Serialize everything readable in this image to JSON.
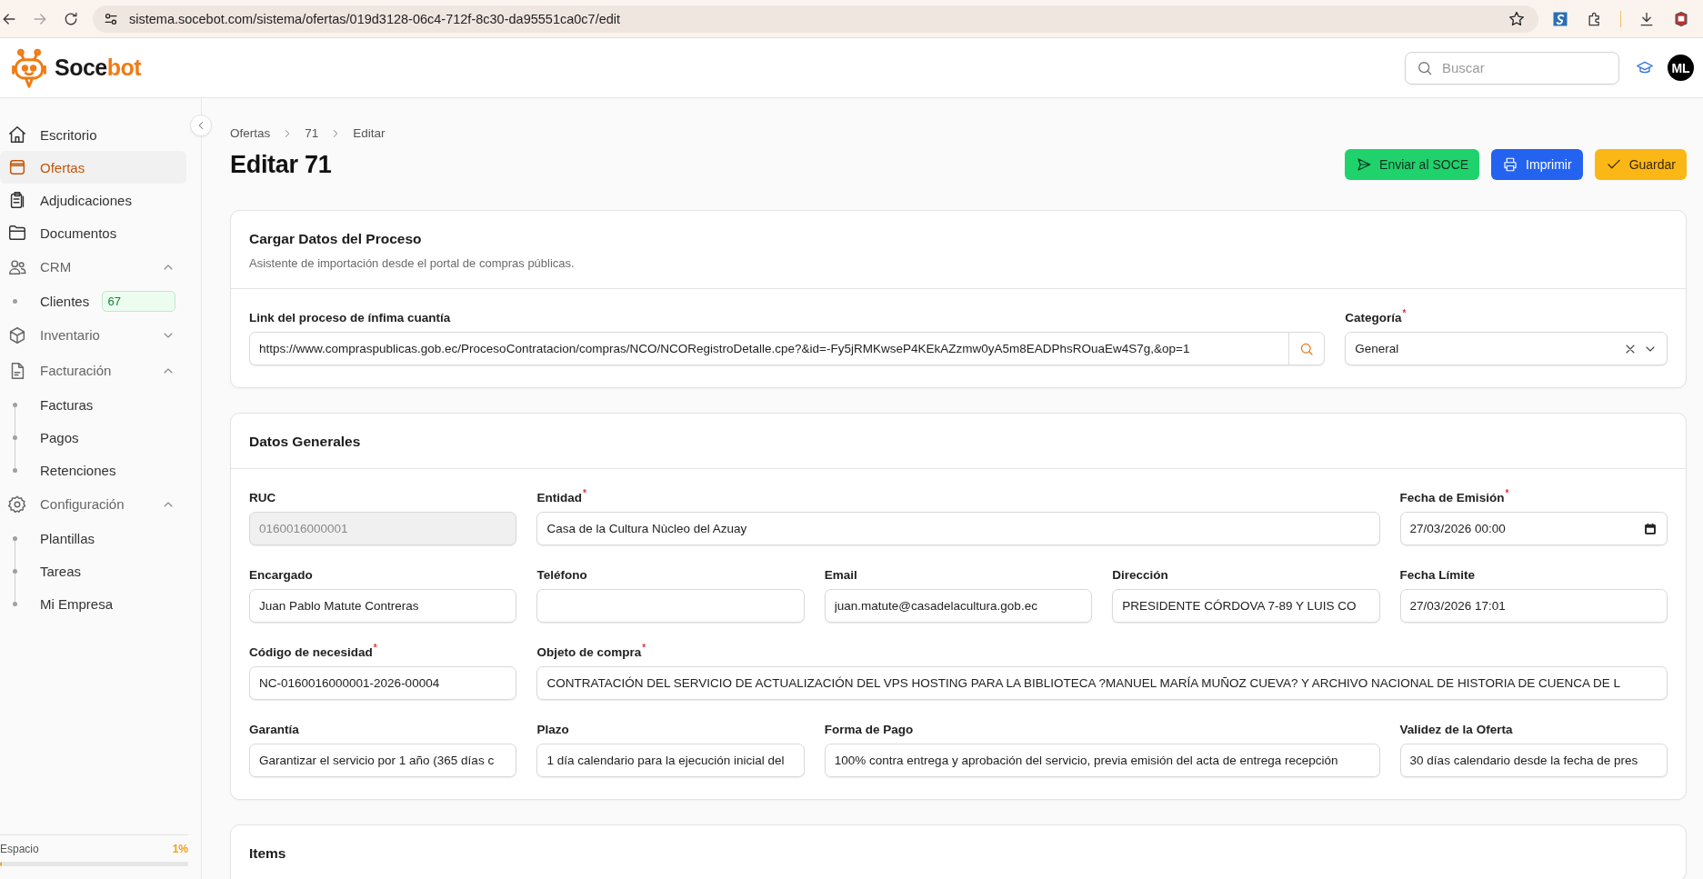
{
  "browser": {
    "url": "sistema.socebot.com/sistema/ofertas/019d3128-06c4-712f-8c30-da95551ca0c7/edit"
  },
  "header": {
    "logo": {
      "first": "Soce",
      "second": "bot"
    },
    "search": {
      "placeholder": "Buscar"
    },
    "avatar": "ML"
  },
  "sidebar": {
    "items": [
      {
        "label": "Escritorio",
        "selected": false
      },
      {
        "label": "Ofertas",
        "selected": true
      },
      {
        "label": "Adjudicaciones",
        "selected": false
      },
      {
        "label": "Documentos",
        "selected": false
      },
      {
        "label": "CRM",
        "selected": false,
        "expanded": true,
        "children": [
          {
            "label": "Clientes",
            "badge": "67",
            "selected": false
          }
        ]
      },
      {
        "label": "Inventario",
        "selected": false,
        "expanded": false
      },
      {
        "label": "Facturación",
        "selected": false,
        "expanded": true,
        "children": [
          {
            "label": "Facturas",
            "selected": false
          },
          {
            "label": "Pagos",
            "selected": false
          },
          {
            "label": "Retenciones",
            "selected": false
          }
        ]
      },
      {
        "label": "Configuración",
        "selected": false,
        "expanded": true,
        "children": [
          {
            "label": "Plantillas",
            "selected": false
          },
          {
            "label": "Tareas",
            "selected": false
          },
          {
            "label": "Mi Empresa",
            "selected": false
          }
        ]
      }
    ],
    "storage": {
      "label": "Espacio",
      "percent": "1%",
      "level": 0.01
    }
  },
  "breadcrumb": [
    "Ofertas",
    "71",
    "Editar"
  ],
  "title": "Editar 71",
  "actions": [
    {
      "label": "Enviar al SOCE",
      "kind": "send"
    },
    {
      "label": "Imprimir",
      "kind": "print"
    },
    {
      "label": "Guardar",
      "kind": "save"
    }
  ],
  "cards": [
    {
      "title": "Cargar Datos del Proceso",
      "subtitle": "Asistente de importación desde el portal de compras públicas.",
      "fields": [
        {
          "label": "Link del proceso de ínfima cuantía",
          "kind": "search",
          "value": "https://www.compraspublicas.gob.ec/ProcesoContratacion/compras/NCO/NCORegistroDetalle.cpe?&id=-Fy5jRMKwseP4KEkAZzmw0yA5m8EADPhsROuaEw4S7g,&op=1"
        },
        {
          "label": "Categoría",
          "required_mark": "*",
          "kind": "select",
          "value": "General"
        }
      ]
    },
    {
      "title": "Datos Generales",
      "fields": [
        {
          "label": "RUC",
          "kind": "text",
          "disabled": true,
          "value": "0160016000001"
        },
        {
          "label": "Entidad",
          "required_mark": "*",
          "kind": "text",
          "value": "Casa de la Cultura Nùcleo del Azuay"
        },
        {
          "label": "Fecha de Emisión",
          "required_mark": "*",
          "kind": "datetime",
          "value": "27/03/2026 00:00"
        },
        {
          "label": "Encargado",
          "kind": "text",
          "value": "Juan Pablo Matute Contreras"
        },
        {
          "label": "Teléfono",
          "kind": "text"
        },
        {
          "label": "Email",
          "kind": "text",
          "value": "juan.matute@casadelacultura.gob.ec"
        },
        {
          "label": "Dirección",
          "kind": "text",
          "value": "PRESIDENTE CÓRDOVA 7-89 Y LUIS CO"
        },
        {
          "label": "Fecha Límite",
          "kind": "text",
          "value": "27/03/2026 17:01"
        },
        {
          "label": "Código de necesidad",
          "required_mark": "*",
          "kind": "text",
          "value": "NC-0160016000001-2026-00004"
        },
        {
          "label": "Objeto de compra",
          "required_mark": "*",
          "kind": "text",
          "value": "CONTRATACIÓN DEL SERVICIO DE ACTUALIZACIÓN DEL VPS HOSTING PARA LA BIBLIOTECA ?MANUEL MARÍA MUÑOZ CUEVA? Y ARCHIVO NACIONAL DE HISTORIA DE CUENCA DE L"
        },
        {
          "label": "Garantía",
          "kind": "text",
          "value": "Garantizar el servicio por 1 año (365 días c"
        },
        {
          "label": "Plazo",
          "kind": "text",
          "value": "1 día calendario para la ejecución inicial del"
        },
        {
          "label": "Forma de Pago",
          "kind": "text",
          "value": "100% contra entrega y aprobación del servicio, previa emisión del acta de entrega recepción"
        },
        {
          "label": "Validez de la Oferta",
          "kind": "text",
          "value": "30 días calendario desde la fecha de pres"
        }
      ]
    },
    {
      "title": "Items"
    }
  ]
}
